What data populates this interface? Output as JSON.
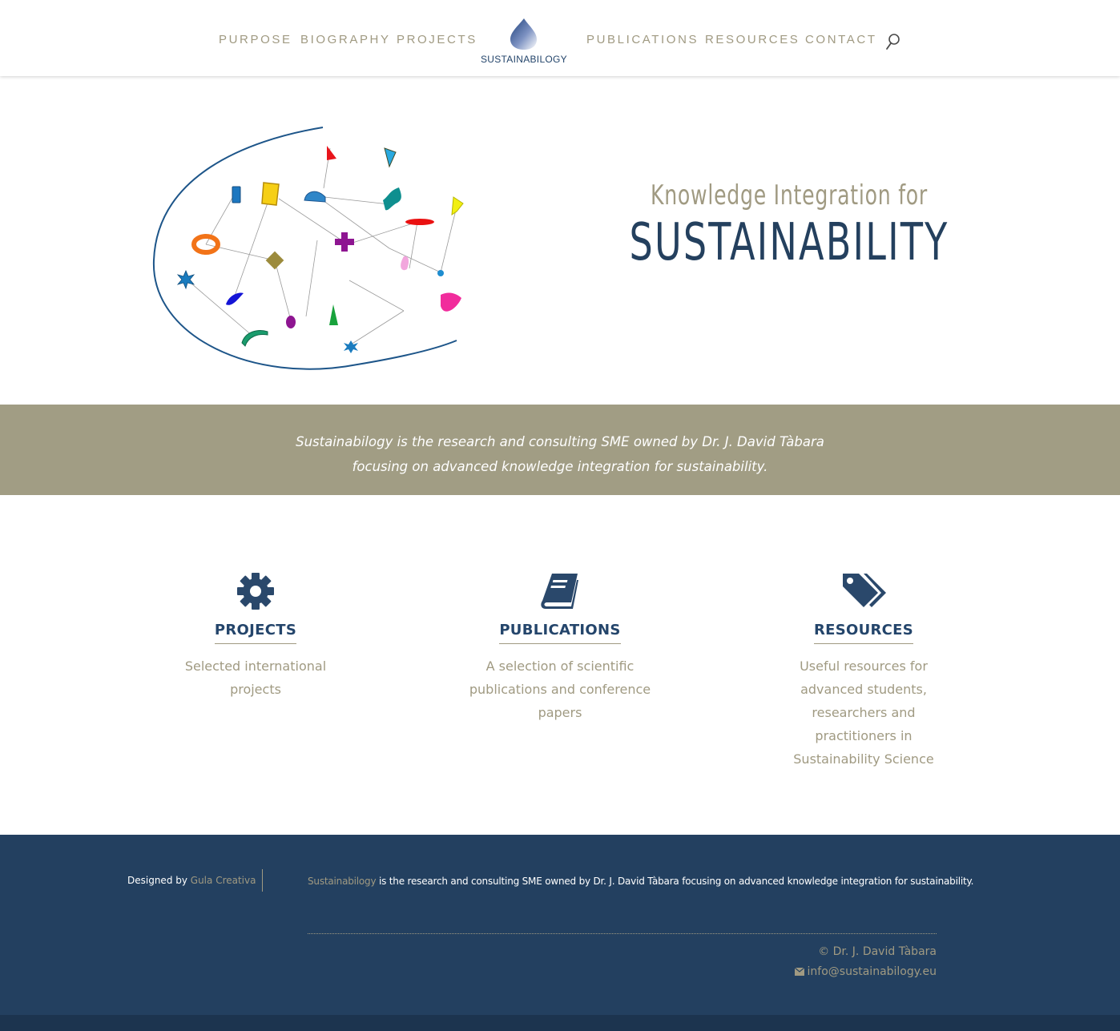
{
  "nav": {
    "left": [
      "PURPOSE",
      "BIOGRAPHY",
      "PROJECTS"
    ],
    "right": [
      "PUBLICATIONS",
      "RESOURCES",
      "CONTACT"
    ],
    "logo_text": "SUSTAINABILOGY",
    "search_icon": "search-icon"
  },
  "hero": {
    "kicker": "Knowledge Integration for",
    "title": "SUSTAINABILITY"
  },
  "band": {
    "line1": "Sustainabilogy is the research and consulting SME owned by Dr. J. David Tàbara",
    "line2": "focusing on advanced knowledge integration for sustainability."
  },
  "features": [
    {
      "icon": "gear-icon",
      "title": "PROJECTS",
      "desc": "Selected international projects"
    },
    {
      "icon": "book-icon",
      "title": "PUBLICATIONS",
      "desc": "A selection of scientific publications and conference papers"
    },
    {
      "icon": "tags-icon",
      "title": "RESOURCES",
      "desc": "Useful resources for advanced students, researchers and practitioners in Sustainability Science"
    }
  ],
  "footer": {
    "designed_prefix": "Designed by ",
    "designed_link": "Gula Creativa",
    "about_link": "Sustainabilogy",
    "about_rest": " is the research and consulting SME owned by Dr. J. David Tàbara focusing on advanced knowledge integration for sustainability.",
    "copyright": "© Dr. J. David Tàbara",
    "email": "info@sustainabilogy.eu"
  },
  "colors": {
    "primary": "#24456b",
    "accent": "#a09a82",
    "band": "#a19d84",
    "footer": "#234060"
  }
}
